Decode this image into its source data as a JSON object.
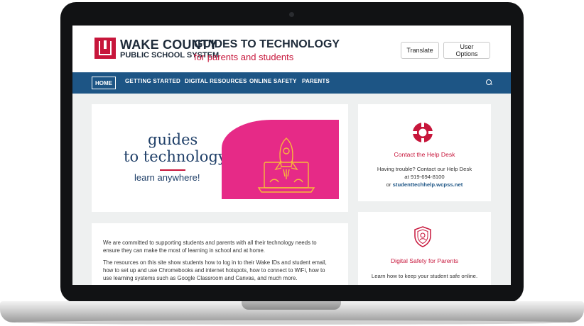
{
  "header": {
    "logo_title": "WAKE COUNTY",
    "logo_subtitle": "PUBLIC SCHOOL SYSTEM",
    "site_title": "GUIDES TO TECHNOLOGY",
    "site_subtitle": "for parents and students",
    "translate_label": "Translate",
    "user_options_label": "User Options"
  },
  "nav": {
    "items": [
      "HOME",
      "GETTING STARTED",
      "DIGITAL RESOURCES",
      "ONLINE SAFETY",
      "PARENTS"
    ],
    "search_icon": "search-icon"
  },
  "banner": {
    "line1": "guides",
    "line2": "to technology",
    "line3": "learn anywhere!"
  },
  "intro": {
    "paragraph1": "We are committed to supporting students and parents with all their technology needs to ensure they can make the most of learning in school and at home.",
    "paragraph2": "The resources on this site show students how to log in to their Wake IDs and student email, how to set up and use Chromebooks and internet hotspots, how to connect to WiFi, how to use learning systems such as Google Classroom and Canvas, and much more."
  },
  "help_desk": {
    "icon": "lifebuoy-icon",
    "heading": "Contact the Help Desk",
    "line1": "Having trouble? Contact our Help Desk",
    "line2": "at 919-694-8100",
    "line3_prefix": "or ",
    "link": "studenttechhelp.wcpss.net"
  },
  "safety": {
    "icon": "shield-icon",
    "heading": "Digital Safety for Parents",
    "text": "Learn how to keep your student safe online."
  },
  "colors": {
    "brand_red": "#c7163b",
    "nav_blue": "#1d5585",
    "banner_pink": "#e62a87",
    "navy_text": "#1f3f68"
  }
}
